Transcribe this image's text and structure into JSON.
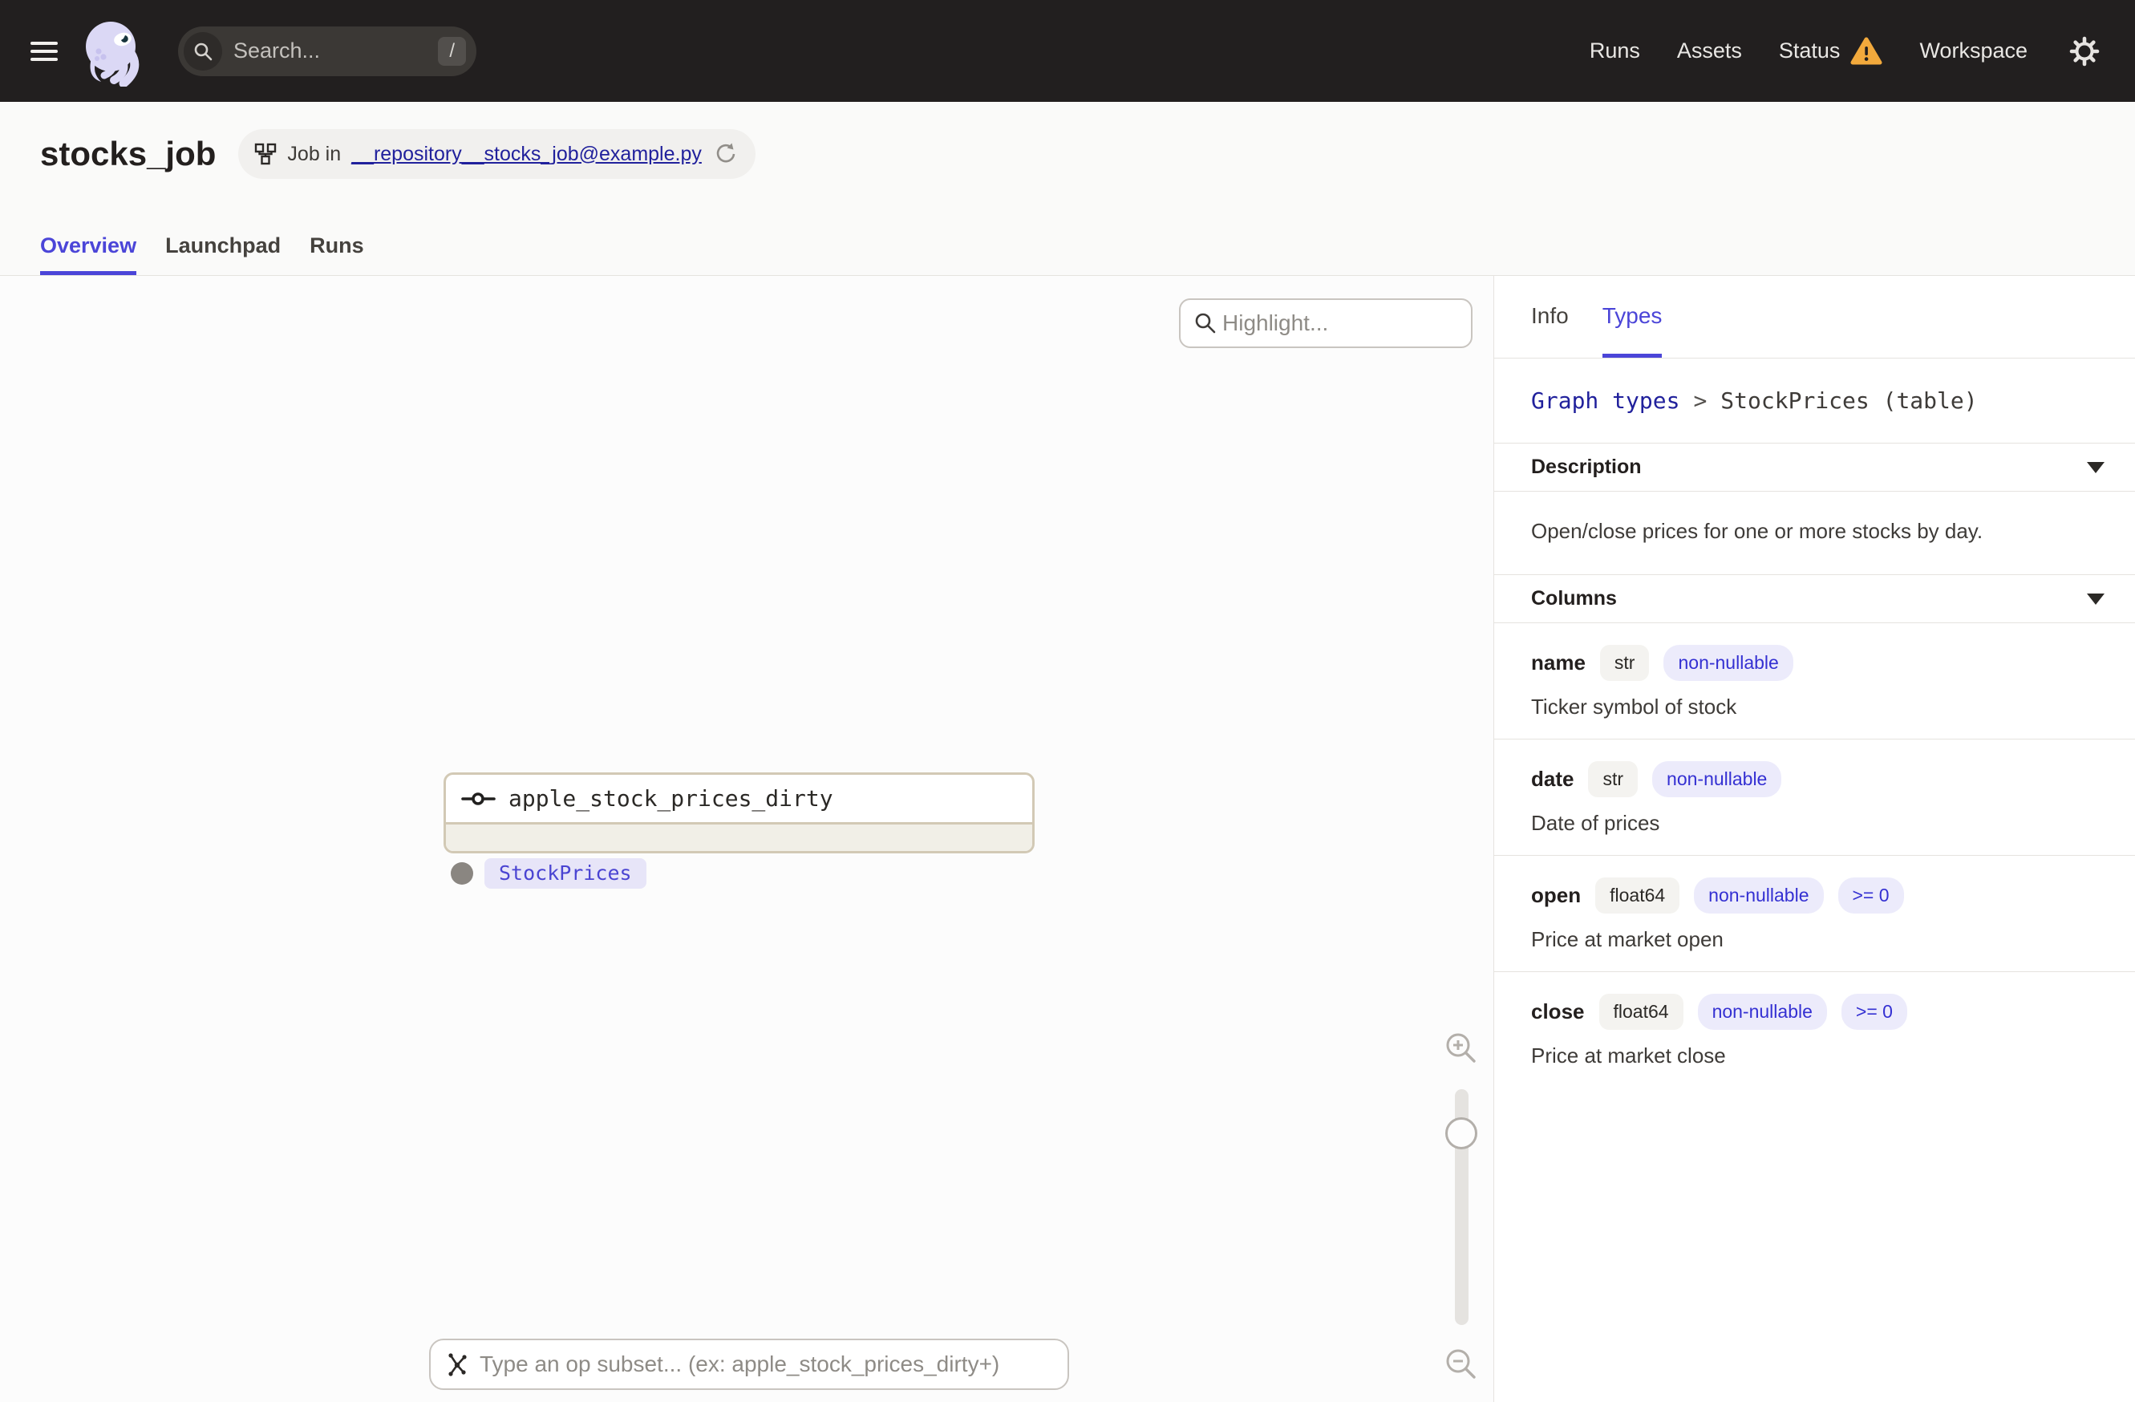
{
  "navbar": {
    "search_placeholder": "Search...",
    "search_shortcut": "/",
    "links": [
      "Runs",
      "Assets",
      "Status",
      "Workspace"
    ]
  },
  "header": {
    "title": "stocks_job",
    "badge_prefix": "Job in",
    "badge_link": "__repository__stocks_job@example.py",
    "tabs": [
      {
        "label": "Overview"
      },
      {
        "label": "Launchpad"
      },
      {
        "label": "Runs"
      }
    ]
  },
  "canvas": {
    "highlight_placeholder": "Highlight...",
    "node": {
      "name": "apple_stock_prices_dirty",
      "output_type": "StockPrices"
    },
    "op_subset_placeholder": "Type an op subset... (ex: apple_stock_prices_dirty+)"
  },
  "panel": {
    "tabs": [
      {
        "label": "Info"
      },
      {
        "label": "Types"
      }
    ],
    "breadcrumb": {
      "link": "Graph types",
      "separator": ">",
      "current": "StockPrices (table)"
    },
    "description": {
      "title": "Description",
      "body": "Open/close prices for one or more stocks by day."
    },
    "columns": {
      "title": "Columns",
      "rows": [
        {
          "name": "name",
          "type": "str",
          "tags": [
            "non-nullable"
          ],
          "description": "Ticker symbol of stock"
        },
        {
          "name": "date",
          "type": "str",
          "tags": [
            "non-nullable"
          ],
          "description": "Date of prices"
        },
        {
          "name": "open",
          "type": "float64",
          "tags": [
            "non-nullable",
            ">= 0"
          ],
          "description": "Price at market open"
        },
        {
          "name": "close",
          "type": "float64",
          "tags": [
            "non-nullable",
            ">= 0"
          ],
          "description": "Price at market close"
        }
      ]
    }
  },
  "colors": {
    "accent_blurple": "#4B45D8",
    "link_navy": "#21219C",
    "warning_orange": "#F2A93C",
    "tag_lavender": "#ECEBFB",
    "node_border_tan": "#D2C9B5",
    "navbar_dark": "#221F1F"
  }
}
